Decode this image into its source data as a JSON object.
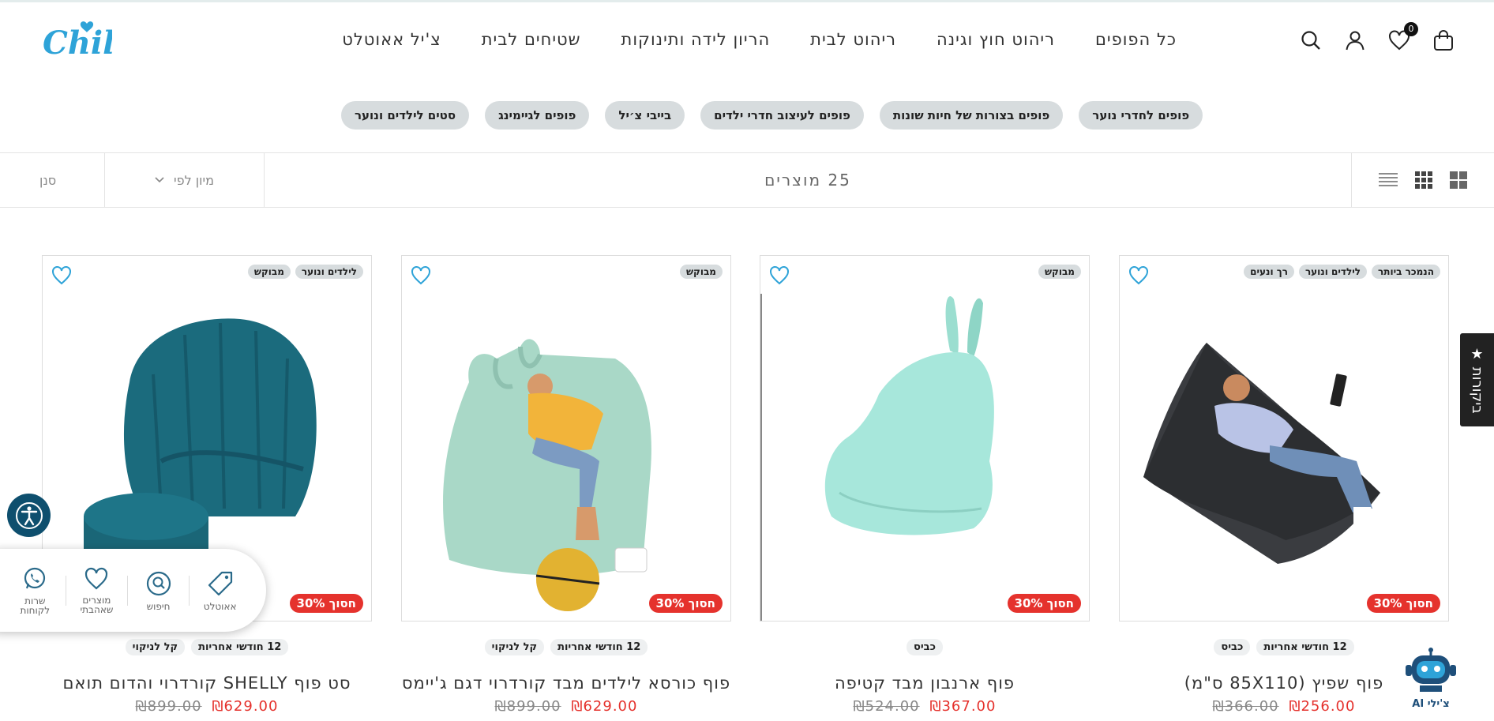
{
  "header": {
    "logo_text": "Chill",
    "nav": [
      "כל הפופים",
      "ריהוט חוץ וגינה",
      "ריהוט לבית",
      "הריון לידה ותינוקות",
      "שטיחים לבית",
      "צ'יל אאוטלט"
    ],
    "cart_count": "0"
  },
  "chips": [
    "פופים לחדרי נוער",
    "פופים בצורות של חיות שונות",
    "פופים לעיצוב חדרי ילדים",
    "בייבי צ׳יל",
    "פופים לגיימינג",
    "סטים לילדים ונוער"
  ],
  "toolbar": {
    "filter_label": "סנן",
    "sort_label": "מיון לפי",
    "count_label": "25 מוצרים"
  },
  "products": [
    {
      "tags": [
        "הנמכר ביותר",
        "לילדים ונוער",
        "רך ונעים"
      ],
      "sale": "חסוך 30%",
      "features": [
        "12 חודשי אחריות",
        "כביס"
      ],
      "name": "פוף שפיץ (85X110 ס\"מ)",
      "price": "₪256.00",
      "old_price": "₪366.00"
    },
    {
      "tags": [
        "מבוקש"
      ],
      "sale": "חסוך 30%",
      "features": [
        "כביס"
      ],
      "name": "פוף ארנבון מבד קטיפה",
      "price": "₪367.00",
      "old_price": "₪524.00"
    },
    {
      "tags": [
        "מבוקש"
      ],
      "sale": "חסוך 30%",
      "features": [
        "12 חודשי אחריות",
        "קל לניקוי"
      ],
      "name": "פוף כורסא לילדים מבד קורדרוי דגם ג'יימס",
      "price": "₪629.00",
      "old_price": "₪899.00"
    },
    {
      "tags": [
        "לילדים ונוער",
        "מבוקש"
      ],
      "sale": "חסוך 30%",
      "features": [
        "12 חודשי אחריות",
        "קל לניקוי"
      ],
      "name": "סט פוף SHELLY קורדרוי והדום תואם",
      "price": "₪629.00",
      "old_price": "₪899.00"
    }
  ],
  "widgets": {
    "reviews_tab": "★ ביקורות",
    "quickbar": [
      "אאוטלט",
      "חיפוש",
      "מוצרים שאהבתי",
      "שרות לקוחות"
    ],
    "bot_label": "צ'ילי AI"
  },
  "colors": {
    "accent": "#2ea3d8",
    "sale": "#e5322d",
    "chip": "#d7dcde"
  }
}
